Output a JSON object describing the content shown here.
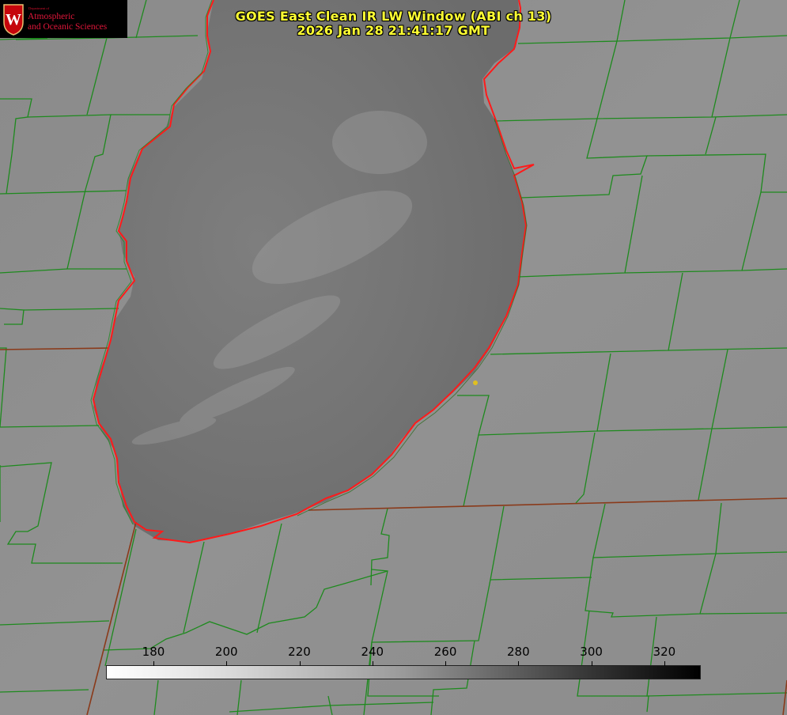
{
  "title": {
    "line1": "GOES East Clean IR LW Window (ABI ch 13)",
    "line2": "2026 Jan 28 21:41:17 GMT"
  },
  "logo": {
    "small_text": "Department of",
    "line1": "Atmospheric",
    "line2": "and Oceanic Sciences",
    "seal_letter": "W"
  },
  "colorbar": {
    "units_note": "",
    "min": 167,
    "max": 330,
    "ticks": [
      "180",
      "200",
      "220",
      "240",
      "260",
      "280",
      "300",
      "320"
    ],
    "tick_values": [
      180,
      200,
      220,
      240,
      260,
      280,
      300,
      320
    ]
  },
  "colors": {
    "background": "#8e8e8e",
    "lake": "#767676",
    "county_lines": "#1e8a1e",
    "state_lines": "#8a3a1a",
    "shoreline": "#ff1a1a",
    "title": "#ffff33",
    "marker": "#e0c020"
  }
}
